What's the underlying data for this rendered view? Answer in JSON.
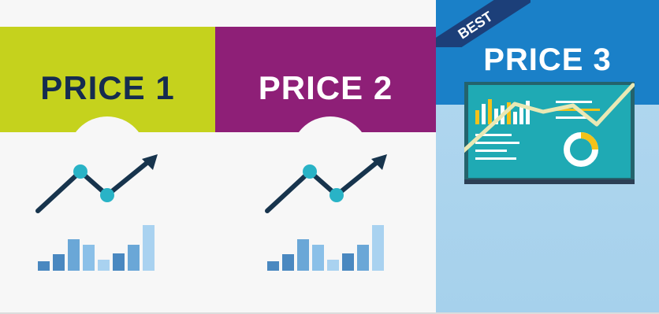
{
  "plans": [
    {
      "title": "PRICE 1"
    },
    {
      "title": "PRICE 2"
    },
    {
      "title": "PRICE 3"
    }
  ],
  "badge": "BEST",
  "colors": {
    "price1_header": "#c5d21d",
    "price2_header": "#8e1f77",
    "price3_header": "#1a80c8",
    "price3_body": "#a6d1ec",
    "badge": "#1c3f79",
    "title_dark": "#152b4f"
  }
}
